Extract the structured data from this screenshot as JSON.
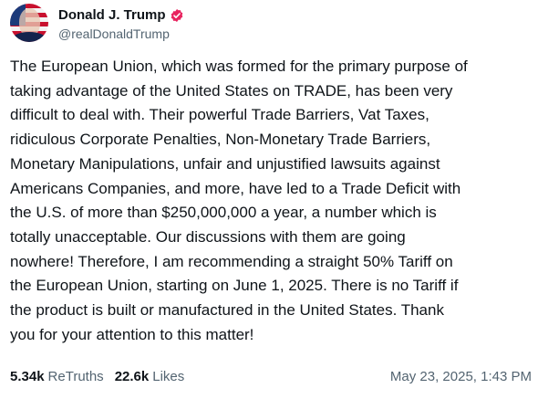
{
  "author": {
    "display_name": "Donald J. Trump",
    "handle": "@realDonaldTrump",
    "verified_icon": "verified-badge-icon"
  },
  "post": {
    "lines": [
      "The European Union, which was formed for the primary purpose of",
      "taking advantage of the United States on TRADE, has been very",
      "difficult to deal with. Their powerful Trade Barriers, Vat Taxes,",
      "ridiculous Corporate Penalties, Non-Monetary Trade Barriers,",
      "Monetary Manipulations, unfair and unjustified lawsuits against",
      "Americans Companies, and more, have led to a Trade Deficit with",
      "the U.S. of more than $250,000,000 a year, a number which is",
      "totally unacceptable. Our discussions with them are going",
      "nowhere! Therefore, I am recommending a straight 50% Tariff on",
      "the European Union, starting on June 1, 2025. There is no Tariff if",
      "the product is built or manufactured in the United States. Thank",
      "you for your attention to this matter!"
    ]
  },
  "stats": {
    "retruths_value": "5.34k",
    "retruths_label": "ReTruths",
    "likes_value": "22.6k",
    "likes_label": "Likes"
  },
  "timestamp": "May 23, 2025, 1:43 PM",
  "colors": {
    "verified_badge": "#e8235f",
    "text_primary": "#0f1419",
    "text_secondary": "#536471"
  }
}
